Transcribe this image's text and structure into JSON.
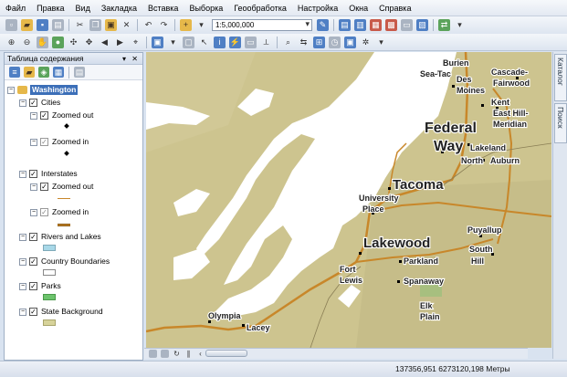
{
  "menu": [
    "Файл",
    "Правка",
    "Вид",
    "Закладка",
    "Вставка",
    "Выборка",
    "Геообработка",
    "Настройка",
    "Окна",
    "Справка"
  ],
  "toolbar": {
    "scale_value": "1:5,000,000"
  },
  "toc": {
    "title": "Таблица содержания",
    "controls": "▾ ✕",
    "root": "Washington",
    "layers": [
      {
        "label": "Cities",
        "sublabels": [
          "Zoomed out",
          "Zoomed in"
        ]
      },
      {
        "label": "Interstates",
        "sublabels": [
          "Zoomed out",
          "Zoomed in"
        ]
      },
      {
        "label": "Rivers and Lakes",
        "color": "#a8d8e8"
      },
      {
        "label": "Country Boundaries",
        "color": "#ffffff"
      },
      {
        "label": "Parks",
        "color": "#6cc36c"
      },
      {
        "label": "State Background",
        "color": "#d7d39a"
      }
    ]
  },
  "map_labels": {
    "burien": "Burien",
    "sea_tac": "Sea-Tac",
    "des_moines": "Des\nMoines",
    "cascade_fairwood": "Cascade-\nFairwood",
    "kent": "Kent",
    "east_hill_meridian": "East Hill-\nMeridian",
    "federal_way": "Federal\nWay",
    "lakeland_north": "Lakeland\nNorth",
    "auburn": "Auburn",
    "tacoma": "Tacoma",
    "university_place": "University\nPlace",
    "lakewood": "Lakewood",
    "puyallup": "Puyallup",
    "south_hill": "South\nHill",
    "parkland": "Parkland",
    "spanaway": "Spanaway",
    "fort_lewis": "Fort\nLewis",
    "elk_plain": "Elk\nPlain",
    "olympia": "Olympia",
    "lacey": "Lacey"
  },
  "side_tabs": [
    "Каталог",
    "Поиск"
  ],
  "status": {
    "coordinates": "137356,951  6273120,198 Метры"
  },
  "colors": {
    "land": "#cdc48f",
    "water": "#ffffff",
    "interstate": "#c8872a",
    "park": "#6cc36c"
  }
}
